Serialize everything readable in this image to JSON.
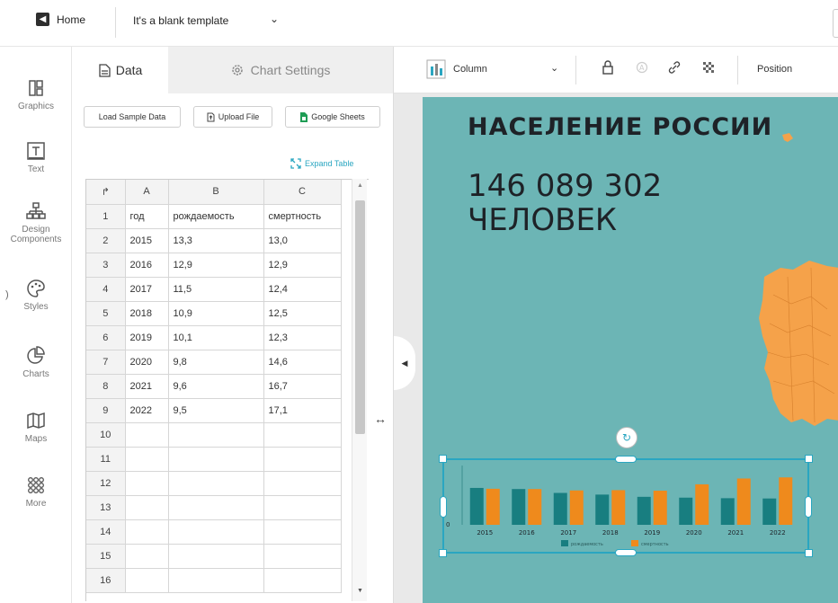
{
  "topbar": {
    "home_label": "Home",
    "template_name": "It's a blank template"
  },
  "rail": {
    "items": [
      {
        "label": "Graphics",
        "icon": "graphics-icon"
      },
      {
        "label": "Text",
        "icon": "text-icon"
      },
      {
        "label": "Design Components",
        "icon": "design-components-icon"
      },
      {
        "label": "Styles",
        "icon": "palette-icon"
      },
      {
        "label": "Charts",
        "icon": "chart-pie-icon"
      },
      {
        "label": "Maps",
        "icon": "map-icon"
      },
      {
        "label": "More",
        "icon": "grid-icon"
      }
    ]
  },
  "panel": {
    "tab_data": "Data",
    "tab_chart_settings": "Chart Settings",
    "btn_load_sample": "Load Sample Data",
    "btn_upload": "Upload File",
    "btn_sheets": "Google Sheets",
    "expand_table": "Expand Table"
  },
  "table": {
    "columns": [
      "A",
      "B",
      "C"
    ],
    "rows": [
      [
        "1",
        "год",
        "рождаемость",
        "смертность"
      ],
      [
        "2",
        "2015",
        "13,3",
        "13,0"
      ],
      [
        "3",
        "2016",
        "12,9",
        "12,9"
      ],
      [
        "4",
        "2017",
        "11,5",
        "12,4"
      ],
      [
        "5",
        "2018",
        "10,9",
        "12,5"
      ],
      [
        "6",
        "2019",
        "10,1",
        "12,3"
      ],
      [
        "7",
        "2020",
        "9,8",
        "14,6"
      ],
      [
        "8",
        "2021",
        "9,6",
        "16,7"
      ],
      [
        "9",
        "2022",
        "9,5",
        "17,1"
      ],
      [
        "10",
        "",
        "",
        ""
      ],
      [
        "11",
        "",
        "",
        ""
      ],
      [
        "12",
        "",
        "",
        ""
      ],
      [
        "13",
        "",
        "",
        ""
      ],
      [
        "14",
        "",
        "",
        ""
      ],
      [
        "15",
        "",
        "",
        ""
      ],
      [
        "16",
        "",
        "",
        ""
      ]
    ]
  },
  "toolbar": {
    "chart_type": "Column",
    "position": "Position"
  },
  "artboard": {
    "headline": "НАСЕЛЕНИЕ РОССИИ",
    "population": "146 089 302\nЧЕЛОВЕК",
    "background": "#6cb5b5",
    "map_color": "#f5a24a"
  },
  "chart_data": {
    "type": "bar",
    "categories": [
      "2015",
      "2016",
      "2017",
      "2018",
      "2019",
      "2020",
      "2021",
      "2022"
    ],
    "series": [
      {
        "name": "рождаемость",
        "values": [
          13.3,
          12.9,
          11.5,
          10.9,
          10.1,
          9.8,
          9.6,
          9.5
        ],
        "color": "#187e80"
      },
      {
        "name": "смертность",
        "values": [
          13.0,
          12.9,
          12.4,
          12.5,
          12.3,
          14.6,
          16.7,
          17.1
        ],
        "color": "#ef8a1c"
      }
    ],
    "y_tick_label": "0",
    "legend_position": "bottom"
  }
}
